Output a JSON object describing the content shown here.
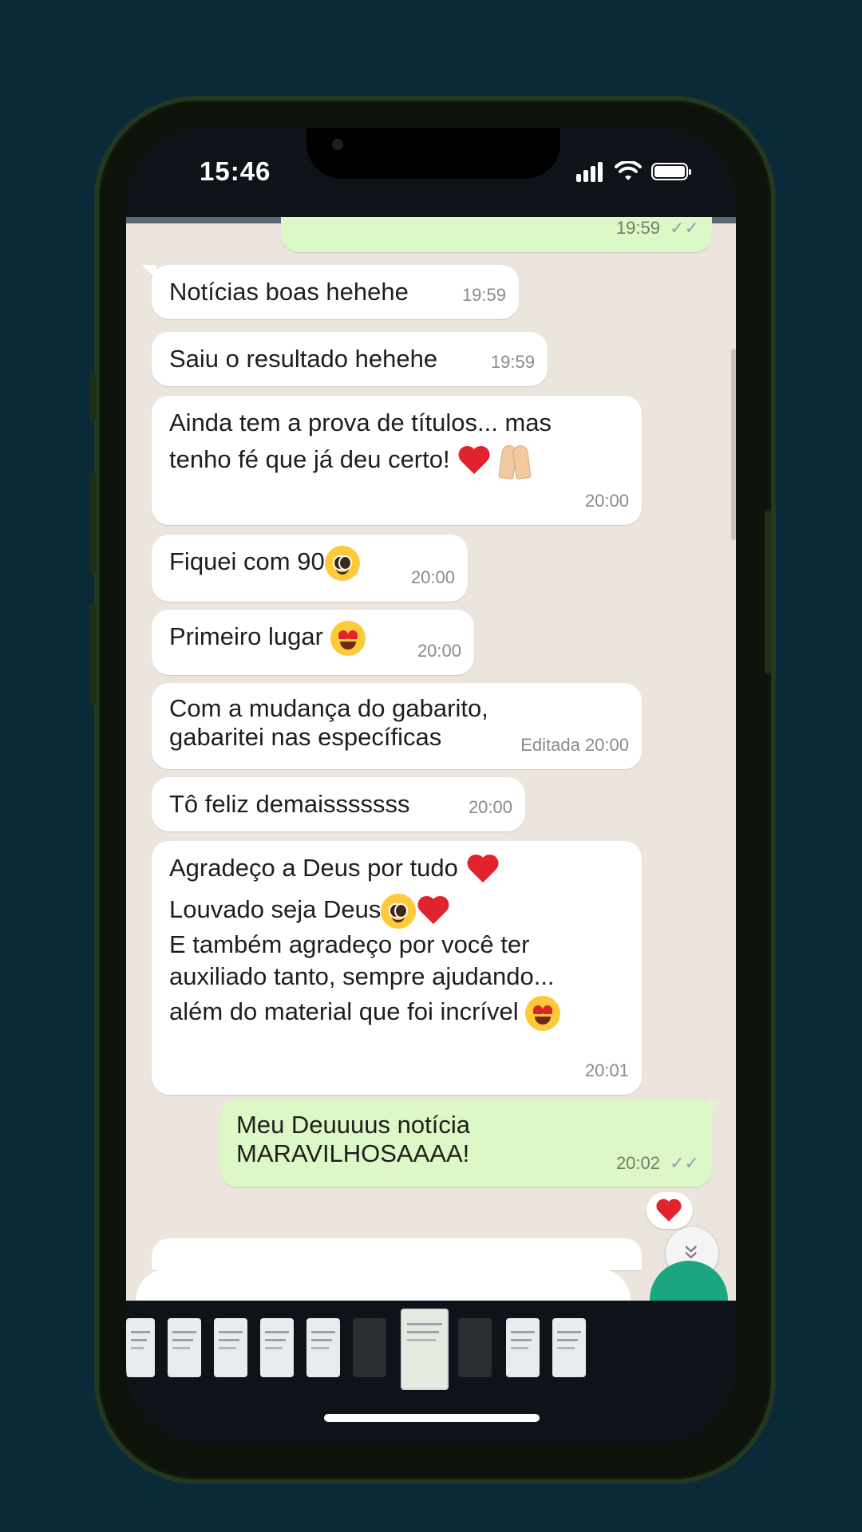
{
  "status": {
    "time": "15:46"
  },
  "messages": [
    {
      "dir": "out",
      "text": "",
      "time": "19:59"
    },
    {
      "dir": "in",
      "text": "Notícias boas hehehe",
      "time": "19:59"
    },
    {
      "dir": "in",
      "text": "Saiu o resultado hehehe",
      "time": "19:59"
    },
    {
      "dir": "in",
      "line1": "Ainda tem a prova de títulos... mas",
      "line2": "tenho fé que já deu certo!",
      "time": "20:00"
    },
    {
      "dir": "in",
      "text": "Fiquei com 90",
      "time": "20:00"
    },
    {
      "dir": "in",
      "text": "Primeiro lugar",
      "time": "20:00"
    },
    {
      "dir": "in",
      "line1": "Com a mudança do gabarito,",
      "line2": "gabaritei nas específicas",
      "edited": "Editada",
      "time": "20:00"
    },
    {
      "dir": "in",
      "text": "Tô feliz demaisssssss",
      "time": "20:00"
    },
    {
      "dir": "in",
      "line1": "Agradeço a Deus por tudo",
      "line2": "Louvado seja Deus",
      "line3": "E também agradeço por você ter",
      "line4": "auxiliado tanto, sempre ajudando...",
      "line5": "além do material que foi incrível",
      "time": "20:01"
    },
    {
      "dir": "out",
      "line1": "Meu Deuuuus notícia",
      "line2": "MARAVILHOSAAAA!",
      "time": "20:02"
    }
  ],
  "icons": {
    "read_receipt": "✓✓",
    "scroll_down": "»"
  }
}
